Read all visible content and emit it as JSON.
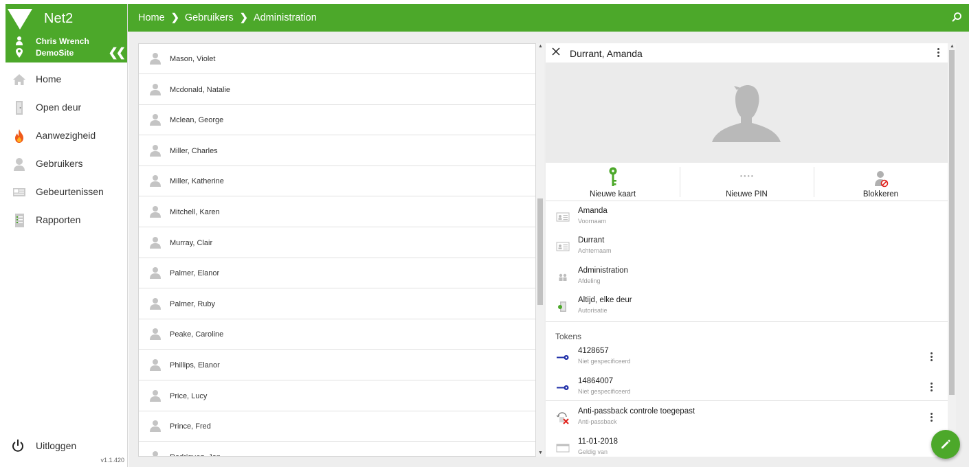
{
  "app": {
    "title": "Net2",
    "version": "v1.1.420"
  },
  "session": {
    "user": "Chris Wrench",
    "site": "DemoSite"
  },
  "colors": {
    "brand": "#4ca82a",
    "token_key": "#1f2fa8",
    "block_red": "#e0221c"
  },
  "nav": [
    {
      "label": "Home",
      "icon": "home-icon"
    },
    {
      "label": "Open deur",
      "icon": "door-icon"
    },
    {
      "label": "Aanwezigheid",
      "icon": "fire-icon"
    },
    {
      "label": "Gebruikers",
      "icon": "user-icon"
    },
    {
      "label": "Gebeurtenissen",
      "icon": "events-icon"
    },
    {
      "label": "Rapporten",
      "icon": "report-icon"
    }
  ],
  "logout_label": "Uitloggen",
  "breadcrumb": [
    "Home",
    "Gebruikers",
    "Administration"
  ],
  "users": [
    "Mason, Violet",
    "Mcdonald, Natalie",
    "Mclean, George",
    "Miller, Charles",
    "Miller, Katherine",
    "Mitchell, Karen",
    "Murray, Clair",
    "Palmer, Elanor",
    "Palmer, Ruby",
    "Peake, Caroline",
    "Phillips, Elanor",
    "Price, Lucy",
    "Prince, Fred",
    "Rodriguez, Jon"
  ],
  "detail": {
    "name": "Durrant, Amanda",
    "actions": [
      {
        "label": "Nieuwe kaart",
        "icon": "key-icon"
      },
      {
        "label": "Nieuwe PIN",
        "icon": "pin-dots-icon",
        "pin_mask": "● ● ● ●"
      },
      {
        "label": "Blokkeren",
        "icon": "block-user-icon"
      }
    ],
    "fields": [
      {
        "value": "Amanda",
        "label": "Voornaam",
        "icon": "id-card-icon"
      },
      {
        "value": "Durrant",
        "label": "Achternaam",
        "icon": "id-card-icon"
      },
      {
        "value": "Administration",
        "label": "Afdeling",
        "icon": "group-icon"
      },
      {
        "value": "Altijd, elke deur",
        "label": "Autorisatie",
        "icon": "door-access-icon"
      }
    ],
    "tokens_heading": "Tokens",
    "tokens": [
      {
        "value": "4128657",
        "label": "Niet gespecificeerd",
        "icon": "key-fob-icon"
      },
      {
        "value": "14864007",
        "label": "Niet gespecificeerd",
        "icon": "key-fob-icon"
      }
    ],
    "extra": [
      {
        "value": "Anti-passback controle toegepast",
        "label": "Anti-passback",
        "icon": "anti-passback-icon"
      },
      {
        "value": "11-01-2018",
        "label": "Geldig van",
        "icon": "calendar-icon"
      }
    ]
  }
}
